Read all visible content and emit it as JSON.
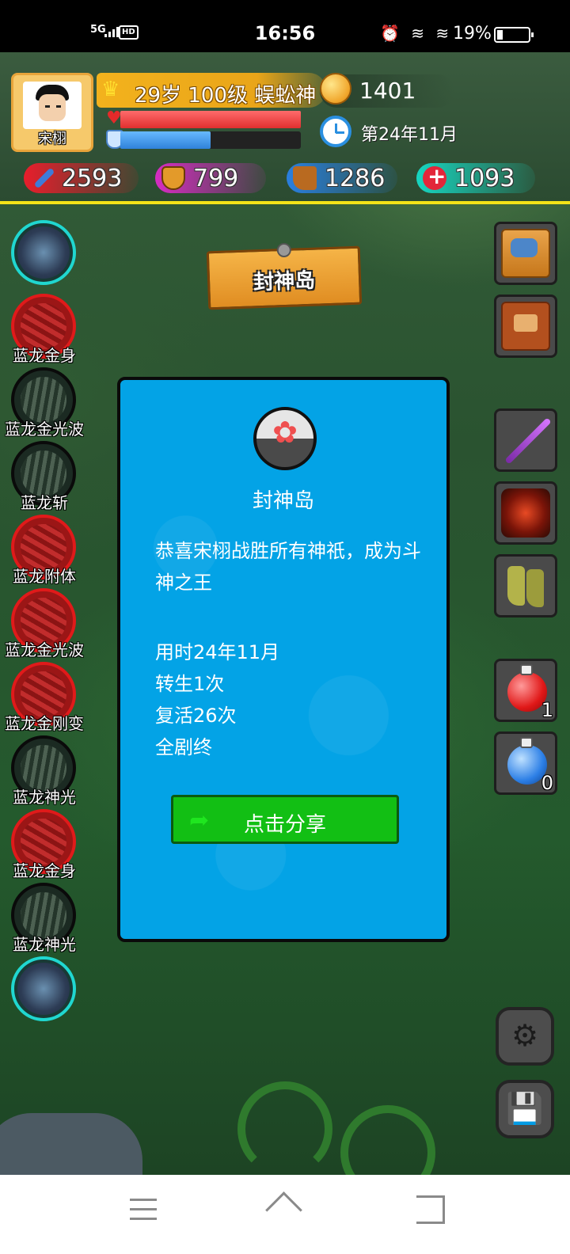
{
  "status_bar": {
    "network": "5G",
    "hd": "HD",
    "time": "16:56",
    "battery_text": "19%",
    "battery_level": 0.19,
    "icons": [
      "alarm-icon",
      "wifi-icon",
      "wifi-icon"
    ]
  },
  "player": {
    "name": "宋栩",
    "title": "29岁 100级 蜈蚣神",
    "hp_fraction": 1.0,
    "mp_fraction": 0.5,
    "coins": "1401",
    "date": "第24年11月"
  },
  "stats": {
    "attack": "2593",
    "defense": "799",
    "speed": "1286",
    "health": "1093"
  },
  "skills": [
    {
      "label": "",
      "style": "big"
    },
    {
      "label": "蓝龙金身",
      "style": "red"
    },
    {
      "label": "蓝龙金光波",
      "style": "dark"
    },
    {
      "label": "蓝龙斩",
      "style": "dark"
    },
    {
      "label": "蓝龙附体",
      "style": "red"
    },
    {
      "label": "蓝龙金光波",
      "style": "red"
    },
    {
      "label": "蓝龙金刚变",
      "style": "red"
    },
    {
      "label": "蓝龙神光",
      "style": "dark"
    },
    {
      "label": "蓝龙金身",
      "style": "red"
    },
    {
      "label": "蓝龙神光",
      "style": "dark"
    },
    {
      "label": "",
      "style": "big"
    }
  ],
  "right_panel": {
    "tiles": [
      "map-icon",
      "book-icon",
      "sword-icon",
      "armor-icon",
      "boots-icon"
    ],
    "red_potion_count": "1",
    "blue_potion_count": "0"
  },
  "location_sign": "封神岛",
  "dialog": {
    "icon": "lotus-icon",
    "title": "封神岛",
    "message": "恭喜宋栩战胜所有神祇，成为斗神之王",
    "lines": [
      "用时24年11月",
      "转生1次",
      "复活26次",
      "全剧终"
    ],
    "share_label": "点击分享"
  },
  "buttons": {
    "settings_icon": "⚙",
    "save_icon": "💾"
  },
  "nav": [
    "menu-icon",
    "home-icon",
    "back-icon"
  ],
  "colors": {
    "hud_border": "#f4e318",
    "dialog_bg": "#03a3e6",
    "share_button": "#12bf14"
  }
}
